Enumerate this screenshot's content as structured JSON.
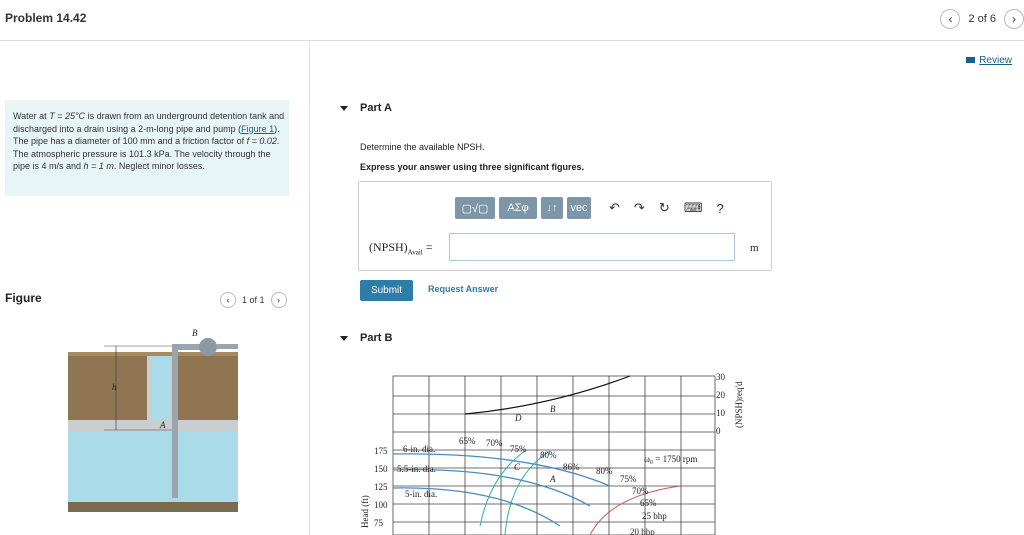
{
  "header": {
    "title": "Problem 14.42",
    "page_indicator": "2 of 6",
    "review_label": "Review"
  },
  "problem": {
    "text_1": "Water at ",
    "text_T": "T = 25°C",
    "text_2": " is drawn from an underground detention tank and discharged into a drain using a 2-m-long pipe and pump (",
    "figure_link": "Figure 1",
    "text_3": "). The pipe has a diameter of 100 mm and a friction factor of ",
    "text_f": "f = 0.02",
    "text_4": ". The atmospheric pressure is 101.3 kPa. The velocity through the pipe is 4 m/s and ",
    "text_h": "h = 1 m",
    "text_5": ". Neglect minor losses."
  },
  "figure": {
    "label": "Figure",
    "page_indicator": "1 of 1",
    "label_B": "B",
    "label_A": "A",
    "label_h": "h"
  },
  "partA": {
    "title": "Part A",
    "question": "Determine the available NPSH.",
    "instruction": "Express your answer using three significant figures.",
    "toolbar": {
      "templates": "▢√▢",
      "greek": "ΑΣφ",
      "arrows": "↓↑",
      "vec": "vec",
      "help": "?"
    },
    "answer_label": "(NPSH)",
    "answer_sub": "Avail",
    "answer_eq": " =",
    "answer_value": "",
    "unit": "m",
    "submit_label": "Submit",
    "request_label": "Request Answer"
  },
  "partB": {
    "title": "Part B"
  },
  "chart_text": {
    "npsh_label": "(NPSH)req'd",
    "head_label": "Head (ft)",
    "npsh_ticks": [
      "30",
      "20",
      "10",
      "0"
    ],
    "head_ticks": [
      "175",
      "150",
      "125",
      "100",
      "75"
    ],
    "dia_6": "6-in. dia.",
    "dia_55": "5.5-in. dia.",
    "dia_5": "5-in. dia.",
    "eff_labels": [
      "65%",
      "70%",
      "75%",
      "80%",
      "86%",
      "80%",
      "75%",
      "70%",
      "65%"
    ],
    "speed": "ω₀ = 1750 rpm",
    "bhp_25": "25 bhp",
    "bhp_20": "20 bhp",
    "pt_D": "D",
    "pt_B": "B",
    "pt_C": "C",
    "pt_A": "A"
  }
}
